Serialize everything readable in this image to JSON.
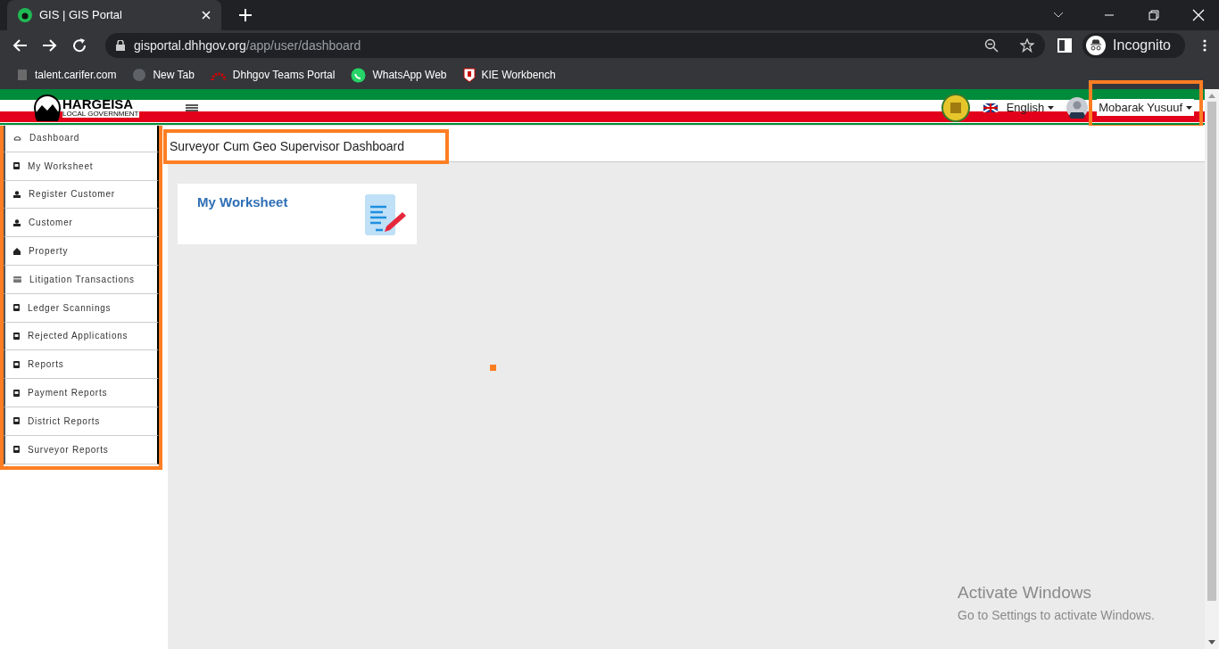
{
  "browser": {
    "tab_title": "GIS | GIS Portal",
    "url_host": "gisportal.dhhgov.org",
    "url_path": "/app/user/dashboard",
    "profile": "Incognito",
    "bookmarks": [
      {
        "label": "talent.carifer.com",
        "kind": "blank"
      },
      {
        "label": "New Tab",
        "kind": "globe"
      },
      {
        "label": "Dhhgov Teams Portal",
        "kind": "arc"
      },
      {
        "label": "WhatsApp Web",
        "kind": "whatsapp"
      },
      {
        "label": "KIE Workbench",
        "kind": "kie"
      }
    ]
  },
  "header": {
    "logo_title": "HARGEISA",
    "logo_subtitle": "LOCAL GOVERNMENT",
    "language": "English",
    "user": "Mobarak Yusuuf",
    "user_highlighted": true
  },
  "sidebar": {
    "highlighted": true,
    "items": [
      {
        "label": "Dashboard",
        "kind": "gauge"
      },
      {
        "label": "My Worksheet",
        "kind": "book"
      },
      {
        "label": "Register Customer",
        "kind": "person"
      },
      {
        "label": "Customer",
        "kind": "person"
      },
      {
        "label": "Property",
        "kind": "home"
      },
      {
        "label": "Litigation Transactions",
        "kind": "card"
      },
      {
        "label": "Ledger Scannings",
        "kind": "book"
      },
      {
        "label": "Rejected Applications",
        "kind": "book"
      },
      {
        "label": "Reports",
        "kind": "book"
      },
      {
        "label": "Payment Reports",
        "kind": "book"
      },
      {
        "label": "District Reports",
        "kind": "book"
      },
      {
        "label": "Surveyor Reports",
        "kind": "book"
      }
    ]
  },
  "page": {
    "title": "Surveyor Cum Geo Supervisor Dashboard",
    "title_highlighted": true,
    "marker_dot": true,
    "tiles": [
      {
        "label": "My Worksheet"
      }
    ]
  },
  "os_notice": {
    "title": "Activate Windows",
    "text": "Go to Settings to activate Windows."
  }
}
